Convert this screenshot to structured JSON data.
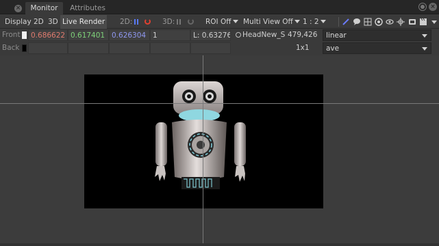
{
  "tabs": [
    {
      "label": "Monitor",
      "active": true
    },
    {
      "label": "Attributes",
      "active": false
    }
  ],
  "toolbar": {
    "display": "Display",
    "mode_2d": "2D",
    "mode_3d": "3D",
    "live_render": "Live Render",
    "label_2d": "2D:",
    "label_3d": "3D:",
    "roi": "ROI Off",
    "multi_view": "Multi View Off",
    "ratio": "1 : 2"
  },
  "front_row": {
    "label": "Front",
    "r": "0.686622",
    "g": "0.617401",
    "b": "0.626304",
    "a": "1",
    "luminance": "L: 0.632760",
    "node": "HeadNew_S",
    "coords": "479,426",
    "lut": "linear"
  },
  "back_row": {
    "label": "Back",
    "sampling": "1x1",
    "mode": "ave"
  },
  "colors": {
    "red_value": "#e07b6e",
    "green_value": "#7fd27a",
    "blue_value": "#8f98f0",
    "accent": "#5a7bff"
  }
}
